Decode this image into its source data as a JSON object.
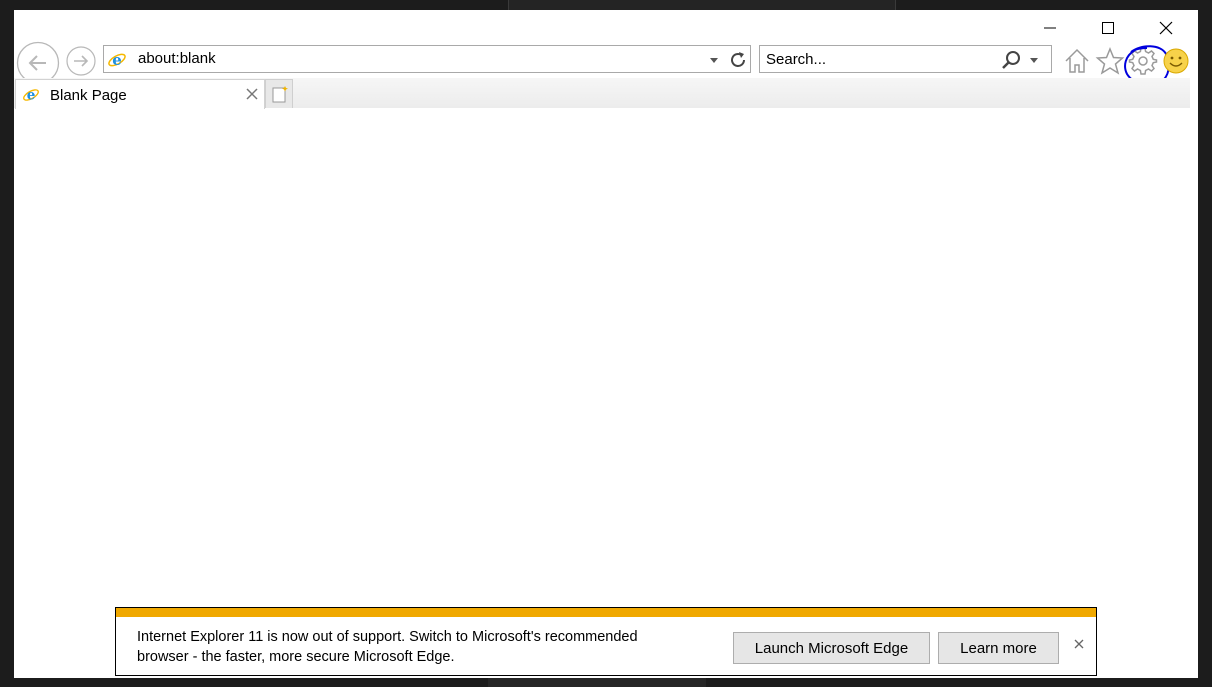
{
  "window": {
    "caption_buttons": [
      "minimize",
      "maximize",
      "close"
    ]
  },
  "toolbar": {
    "address": "about:blank",
    "search_placeholder": "Search...",
    "icons": [
      "back-icon",
      "forward-icon",
      "ie-icon",
      "dropdown-icon",
      "refresh-icon",
      "search-icon",
      "home-icon",
      "favorites-star-icon",
      "settings-gear-icon",
      "smiley-feedback-icon"
    ]
  },
  "tabs": [
    {
      "title": "Blank Page",
      "active": true
    }
  ],
  "notification": {
    "message_line1": "Internet Explorer 11 is now out of support. Switch to Microsoft's recommended",
    "message_line2": "browser - the faster, more secure Microsoft Edge.",
    "launch_button": "Launch Microsoft Edge",
    "learn_button": "Learn more",
    "stripe_color": "#f0a800"
  },
  "colors": {
    "annotation": "#0000dd",
    "ie_blue": "#1e90e0",
    "ie_ring": "#f5b800"
  }
}
